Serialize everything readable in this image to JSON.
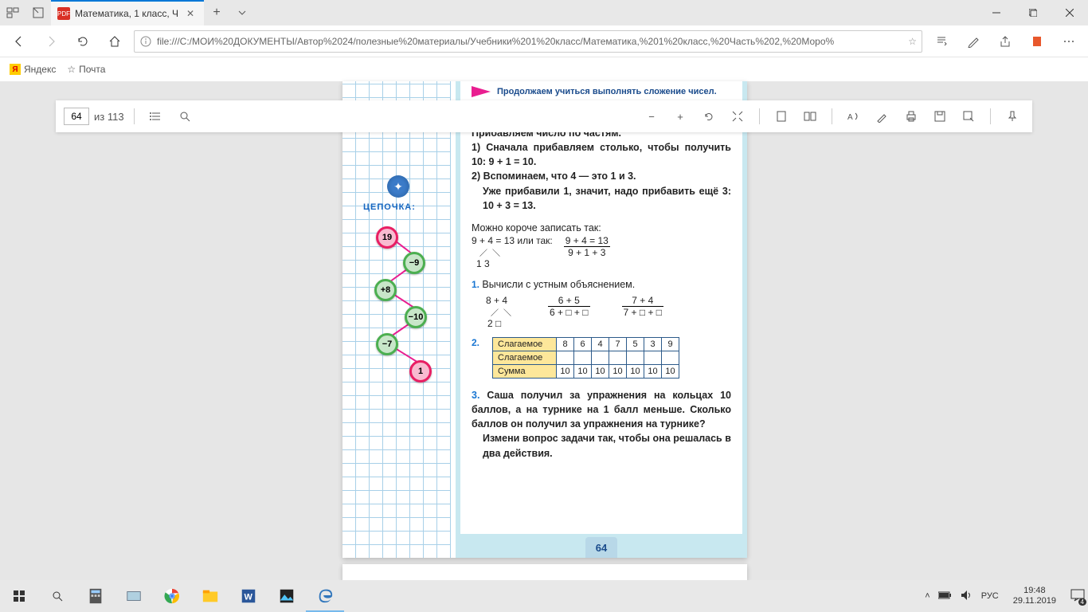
{
  "titlebar": {
    "tab_title": "Математика, 1 класс, Ч"
  },
  "nav": {
    "url": "file:///C:/МОИ%20ДОКУМЕНТЫ/Автор%2024/полезные%20материалы/Учебники%201%20класс/Математика,%201%20класс,%20Часть%202,%20Моро%"
  },
  "fav": {
    "yandex": "Яндекс",
    "mail": "Почта"
  },
  "pdftb": {
    "page": "64",
    "of": "из 113"
  },
  "doc": {
    "header": "Продолжаем учиться выполнять сложение чисел.",
    "t0": "Прибавляем число по частям.",
    "t1a": "1) Сначала прибавляем столько, чтобы получить 10:   9 + 1 = 10.",
    "t2a": "2) Вспоминаем, что 4 — это 1 и 3.",
    "t2b": "Уже прибавили 1, значит, надо прибавить ещё 3:   10 + 3 = 13.",
    "short": "Можно короче записать так:",
    "eq1": "9 + 4 = 13  или  так:",
    "f1t": "9 + 4 = 13",
    "f1b": "9 + 1 + 3",
    "split": "1 3",
    "task1": "Вычисли с устным объяснением.",
    "e1": "8 + 4",
    "e1b": "2 □",
    "f2t": "6 + 5",
    "f2b": "6 + □ + □",
    "f3t": "7 + 4",
    "f3b": "7 + □ + □",
    "row1": "Слагаемое",
    "row2": "Слагаемое",
    "row3": "Сумма",
    "r1": [
      "8",
      "6",
      "4",
      "7",
      "5",
      "3",
      "9"
    ],
    "r3": [
      "10",
      "10",
      "10",
      "10",
      "10",
      "10",
      "10"
    ],
    "task3": "Саша получил за упражнения на кольцах 10 баллов, а на турнике на 1 балл меньше. Сколько баллов он получил за упражнения на турнике?",
    "task3b": "Измени вопрос задачи так, чтобы она решалась в два действия.",
    "pagenum": "64",
    "chain_title": "ЦЕПОЧКА:",
    "chain": [
      "19",
      "−9",
      "+8",
      "−10",
      "−7",
      "1"
    ]
  },
  "tray": {
    "lang": "РУС",
    "time": "19:48",
    "date": "29.11.2019",
    "badge": "4"
  }
}
